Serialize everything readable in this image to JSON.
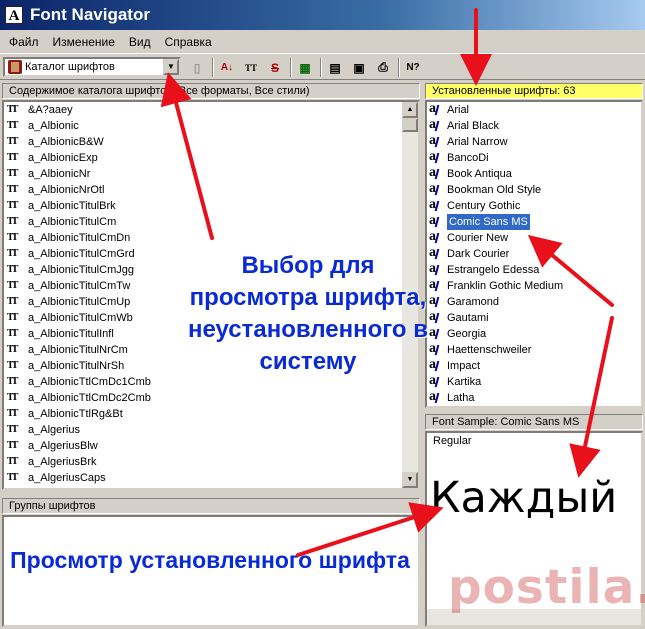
{
  "window": {
    "title": "Font Navigator",
    "icon_glyph": "A"
  },
  "menu": [
    "Файл",
    "Изменение",
    "Вид",
    "Справка"
  ],
  "toolbar": {
    "catalog_combo_value": "Каталог шрифтов",
    "buttons": [
      {
        "name": "folder-icon",
        "glyph": "▯"
      },
      {
        "name": "sort-az-icon",
        "glyph": "A↓"
      },
      {
        "name": "font-size-icon",
        "glyph": "TT"
      },
      {
        "name": "strikethrough-icon",
        "glyph": "S"
      },
      {
        "name": "install-icon",
        "glyph": "▦"
      },
      {
        "name": "properties-icon",
        "glyph": "▤"
      },
      {
        "name": "preview-icon",
        "glyph": "▣"
      },
      {
        "name": "print-icon",
        "glyph": "⎙"
      },
      {
        "name": "help-icon",
        "glyph": "N?"
      }
    ]
  },
  "catalog_panel": {
    "header": "Содержимое каталога шрифтов (Все форматы, Все стили)",
    "items": [
      "&A?aaey",
      "a_Albionic",
      "a_AlbionicB&W",
      "a_AlbionicExp",
      "a_AlbionicNr",
      "a_AlbionicNrOtl",
      "a_AlbionicTitulBrk",
      "a_AlbionicTitulCm",
      "a_AlbionicTitulCmDn",
      "a_AlbionicTitulCmGrd",
      "a_AlbionicTitulCmJgg",
      "a_AlbionicTitulCmTw",
      "a_AlbionicTitulCmUp",
      "a_AlbionicTitulCmWb",
      "a_AlbionicTitulInfl",
      "a_AlbionicTitulNrCm",
      "a_AlbionicTitulNrSh",
      "a_AlbionicTtlCmDc1Cmb",
      "a_AlbionicTtlCmDc2Cmb",
      "a_AlbionicTtlRg&Bt",
      "a_Algerius",
      "a_AlgeriusBlw",
      "a_AlgeriusBrk",
      "a_AlgeriusCaps"
    ]
  },
  "groups_panel": {
    "header": "Группы шрифтов"
  },
  "installed_panel": {
    "header": "Установленные шрифты: 63",
    "items": [
      "Arial",
      "Arial Black",
      "Arial Narrow",
      "BancoDi",
      "Book Antiqua",
      "Bookman Old Style",
      "Century Gothic",
      "Comic Sans MS",
      "Courier New",
      "Dark Courier",
      "Estrangelo Edessa",
      "Franklin Gothic Medium",
      "Garamond",
      "Gautami",
      "Georgia",
      "Haettenschweiler",
      "Impact",
      "Kartika",
      "Latha"
    ],
    "selected": "Comic Sans MS"
  },
  "sample_panel": {
    "header": "Font Sample:  Comic Sans MS",
    "style": "Regular",
    "text": "Каждый"
  },
  "annotations": {
    "catalog_note": "Выбор для просмотра шрифта, неустановленного в систему",
    "installed_note": "Просмотр установленного шрифта"
  },
  "watermark": "postila.ru",
  "colors": {
    "selection": "#316ac5",
    "annotation_text": "#0a2bd4",
    "arrow": "#e8101a",
    "installed_header_highlight": "#ffff66"
  }
}
